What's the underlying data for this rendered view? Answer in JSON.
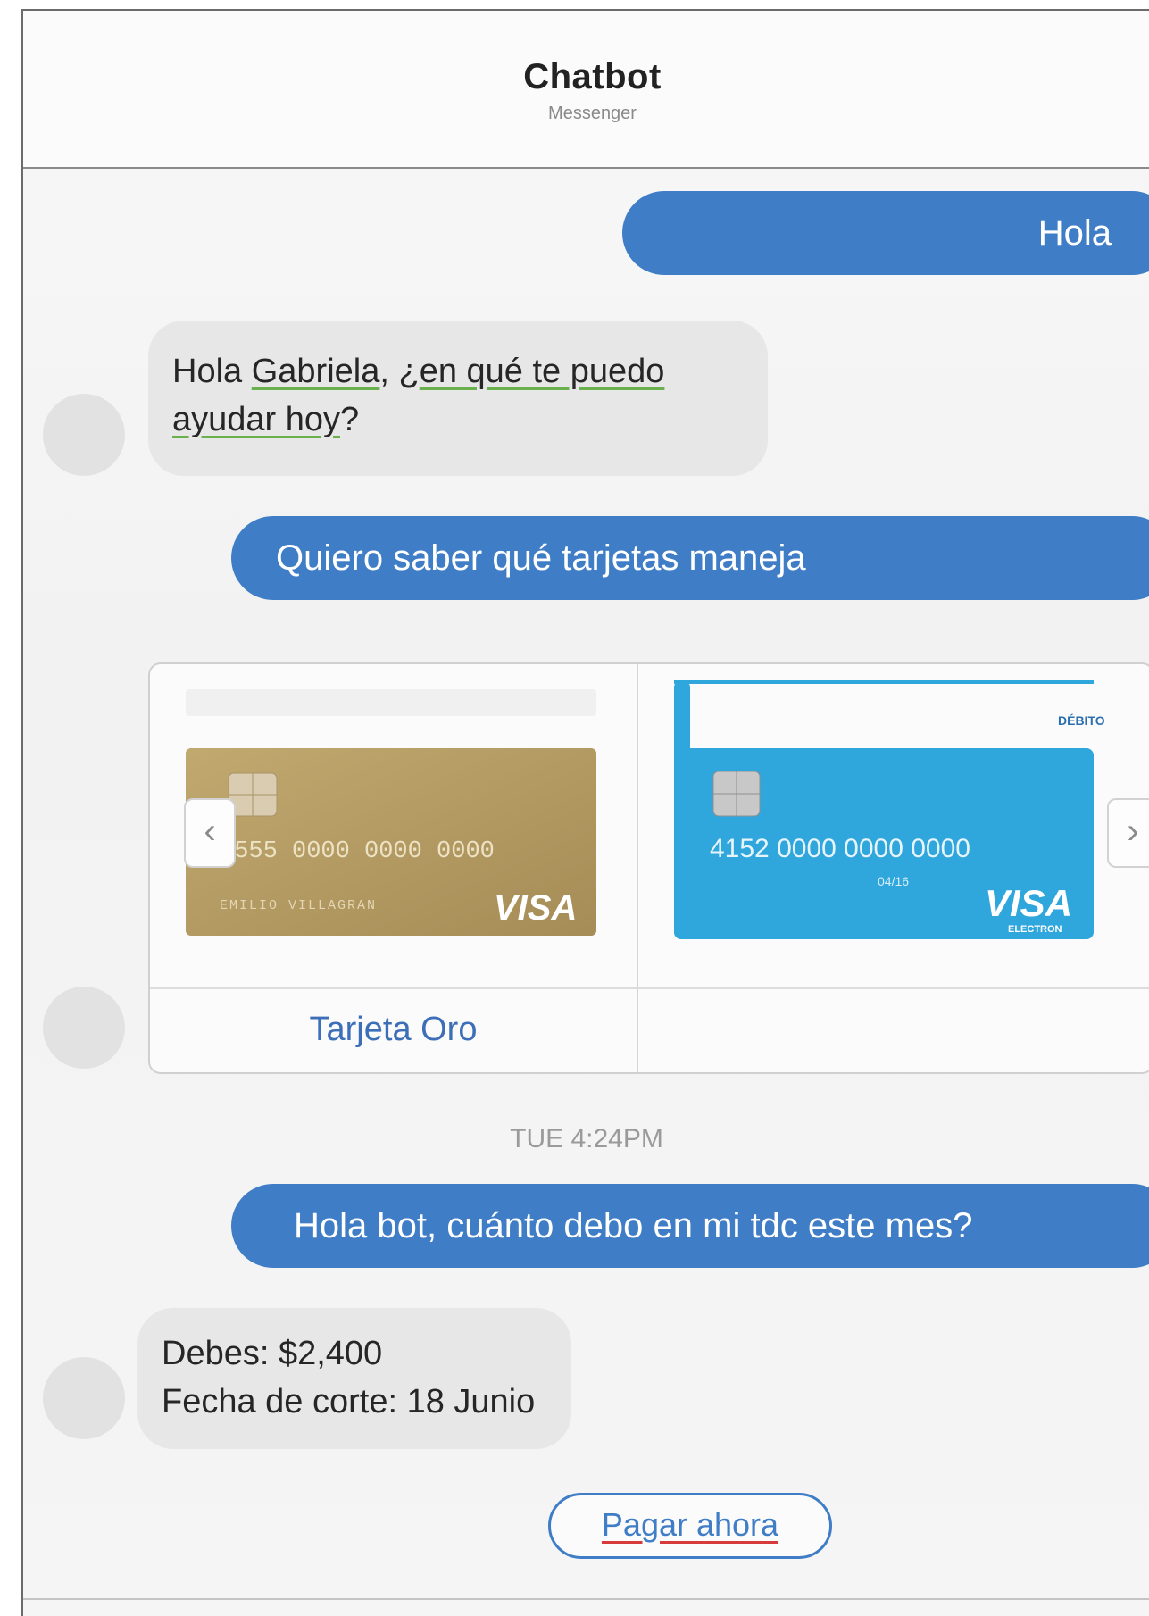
{
  "header": {
    "title": "Chatbot",
    "subtitle": "Messenger"
  },
  "messages": {
    "m1": "Hola",
    "m2_line1_a": "Hola ",
    "m2_line1_b": "Gabriela",
    "m2_line1_c": ", ¿",
    "m2_line1_d": "en qué te puedo",
    "m2_line2_a": "ayudar hoy",
    "m2_line2_b": "?",
    "m3": "Quiero saber qué tarjetas maneja",
    "m4": "Hola bot, cuánto debo en mi tdc este mes?",
    "m5_line1": "Debes: $2,400",
    "m5_line2": "Fecha de corte: 18 Junio"
  },
  "carousel": {
    "card1": {
      "number": "4555  0000  0000  0000",
      "holder": "EMILIO VILLAGRAN",
      "brand": "VISA",
      "caption": "Tarjeta Oro"
    },
    "card2": {
      "number": "4152 0000 0000 0000",
      "tag": "DÉBITO",
      "expiry": "04/16",
      "brand": "VISA",
      "brand_sub": "ELECTRON",
      "caption": ""
    },
    "prev_icon": "chevron-left-icon",
    "next_icon": "chevron-right-icon"
  },
  "timestamp": "TUE 4:24PM",
  "quick_reply": "Pagar ahora",
  "colors": {
    "outgoing": "#3f7dc6",
    "incoming": "#e7e7e7",
    "gold_card": "#b49a5f",
    "debit_card": "#2fa6dc"
  }
}
